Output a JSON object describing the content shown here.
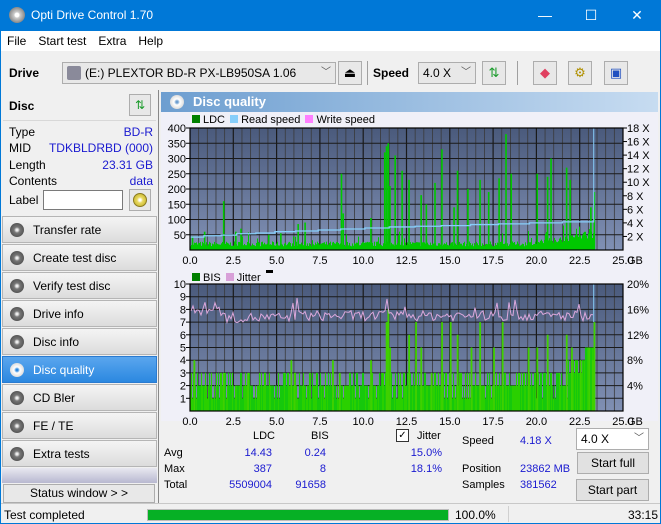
{
  "window": {
    "title": "Opti Drive Control 1.70",
    "controls": {
      "minimize": "—",
      "maximize": "☐",
      "close": "✕"
    }
  },
  "menu": [
    "File",
    "Start test",
    "Extra",
    "Help"
  ],
  "toolbar": {
    "drive_label": "Drive",
    "drive_value": "(E:)  PLEXTOR BD-R  PX-LB950SA 1.06",
    "speed_label": "Speed",
    "speed_value": "4.0 X",
    "icons": [
      "eject-icon",
      "refresh-icon",
      "erase-icon",
      "settings-icon",
      "save-icon"
    ]
  },
  "disc": {
    "header": "Disc",
    "rows": [
      {
        "key": "Type",
        "value": "BD-R"
      },
      {
        "key": "MID",
        "value": "TDKBLDRBD (000)"
      },
      {
        "key": "Length",
        "value": "23.31 GB"
      },
      {
        "key": "Contents",
        "value": "data"
      }
    ],
    "label_key": "Label",
    "label_value": ""
  },
  "nav": [
    {
      "label": "Transfer rate",
      "active": false
    },
    {
      "label": "Create test disc",
      "active": false
    },
    {
      "label": "Verify test disc",
      "active": false
    },
    {
      "label": "Drive info",
      "active": false
    },
    {
      "label": "Disc info",
      "active": false
    },
    {
      "label": "Disc quality",
      "active": true
    },
    {
      "label": "CD Bler",
      "active": false
    },
    {
      "label": "FE / TE",
      "active": false
    },
    {
      "label": "Extra tests",
      "active": false
    }
  ],
  "status_window_button": "Status window > >",
  "panel": {
    "title": "Disc quality"
  },
  "chart_data": [
    {
      "type": "bar",
      "title": "LDC",
      "legend": [
        {
          "name": "LDC",
          "color": "#008000"
        },
        {
          "name": "Read speed",
          "color": "#87cefa"
        },
        {
          "name": "Write speed",
          "color": "#ff80ff"
        }
      ],
      "xlabel": "GB",
      "x_ticks": [
        "0.0",
        "2.5",
        "5.0",
        "7.5",
        "10.0",
        "12.5",
        "15.0",
        "17.5",
        "20.0",
        "22.5",
        "25.0"
      ],
      "xlim": [
        0,
        25
      ],
      "y_ticks": [
        "50",
        "100",
        "150",
        "200",
        "250",
        "300",
        "350",
        "400"
      ],
      "ylim": [
        0,
        400
      ],
      "y2_ticks": [
        "2 X",
        "4 X",
        "6 X",
        "8 X",
        "10 X",
        "12 X",
        "14 X",
        "16 X",
        "18 X"
      ],
      "y2lim": [
        0,
        18
      ],
      "baseline": 20,
      "spikes": [
        [
          0.1,
          45
        ],
        [
          0.8,
          60
        ],
        [
          1.9,
          160
        ],
        [
          2.6,
          60
        ],
        [
          2.9,
          70
        ],
        [
          4.5,
          50
        ],
        [
          5.2,
          55
        ],
        [
          6.2,
          85
        ],
        [
          6.6,
          90
        ],
        [
          8.7,
          250
        ],
        [
          8.8,
          120
        ],
        [
          10.4,
          105
        ],
        [
          11.2,
          320
        ],
        [
          11.3,
          340
        ],
        [
          11.4,
          350
        ],
        [
          11.5,
          210
        ],
        [
          11.8,
          310
        ],
        [
          12.2,
          260
        ],
        [
          12.6,
          230
        ],
        [
          13.3,
          180
        ],
        [
          13.6,
          150
        ],
        [
          14.1,
          220
        ],
        [
          14.5,
          330
        ],
        [
          15.2,
          140
        ],
        [
          15.4,
          260
        ],
        [
          16.0,
          200
        ],
        [
          16.7,
          230
        ],
        [
          17.2,
          190
        ],
        [
          17.8,
          235
        ],
        [
          18.2,
          380
        ],
        [
          18.5,
          250
        ],
        [
          20.0,
          250
        ],
        [
          20.6,
          240
        ],
        [
          20.8,
          300
        ],
        [
          21.7,
          270
        ],
        [
          21.9,
          230
        ],
        [
          23.1,
          140
        ],
        [
          23.3,
          190
        ]
      ],
      "read_speed": [
        [
          0,
          1.9
        ],
        [
          0.8,
          2.1
        ],
        [
          1.8,
          2.2
        ],
        [
          2.7,
          2.4
        ],
        [
          3.8,
          2.5
        ],
        [
          4.9,
          2.7
        ],
        [
          6.1,
          2.8
        ],
        [
          7.4,
          2.95
        ],
        [
          8.7,
          3.1
        ],
        [
          10.1,
          3.25
        ],
        [
          11.5,
          3.4
        ],
        [
          13.0,
          3.5
        ],
        [
          14.5,
          3.6
        ],
        [
          16.2,
          3.75
        ],
        [
          17.8,
          3.85
        ],
        [
          19.6,
          4.0
        ],
        [
          21.5,
          4.15
        ],
        [
          23.3,
          4.18
        ]
      ],
      "end_gb": 23.31
    },
    {
      "type": "bar",
      "title": "BIS",
      "legend": [
        {
          "name": "BIS",
          "color": "#008000"
        },
        {
          "name": "Jitter",
          "color": "#d8a0d8"
        }
      ],
      "xlabel": "GB",
      "x_ticks": [
        "0.0",
        "2.5",
        "5.0",
        "7.5",
        "10.0",
        "12.5",
        "15.0",
        "17.5",
        "20.0",
        "22.5",
        "25.0"
      ],
      "xlim": [
        0,
        25
      ],
      "y_ticks": [
        "1",
        "2",
        "3",
        "4",
        "5",
        "6",
        "7",
        "8",
        "9",
        "10"
      ],
      "ylim": [
        0,
        10
      ],
      "y2_ticks": [
        "4%",
        "8%",
        "12%",
        "16%",
        "20%"
      ],
      "y2lim": [
        0,
        20
      ],
      "bis_spikes": [
        [
          0.2,
          4
        ],
        [
          1.9,
          3
        ],
        [
          3.3,
          3
        ],
        [
          5.8,
          4
        ],
        [
          6.0,
          3
        ],
        [
          8.2,
          4
        ],
        [
          8.6,
          3
        ],
        [
          10.4,
          4
        ],
        [
          11.3,
          7
        ],
        [
          11.4,
          8
        ],
        [
          11.5,
          5
        ],
        [
          12.6,
          6
        ],
        [
          13.0,
          7
        ],
        [
          13.3,
          5
        ],
        [
          13.9,
          3
        ],
        [
          14.5,
          7
        ],
        [
          15.0,
          7
        ],
        [
          15.4,
          6
        ],
        [
          16.2,
          5
        ],
        [
          16.7,
          7
        ],
        [
          17.5,
          5
        ],
        [
          18.0,
          7
        ],
        [
          19.5,
          5
        ],
        [
          20.0,
          5
        ],
        [
          20.6,
          6
        ],
        [
          21.7,
          6
        ],
        [
          22.0,
          5
        ],
        [
          22.5,
          4
        ],
        [
          23.0,
          5
        ],
        [
          23.2,
          4
        ],
        [
          23.3,
          7
        ]
      ],
      "jitter_avg_pct": 15.0,
      "jitter_max_pct": 18.1,
      "end_gb": 23.31
    }
  ],
  "stats": {
    "col_ldc": "LDC",
    "col_bis": "BIS",
    "jitter_label": "Jitter",
    "jitter_checked": true,
    "rows": [
      {
        "label": "Avg",
        "ldc": "14.43",
        "bis": "0.24",
        "jitter": "15.0%"
      },
      {
        "label": "Max",
        "ldc": "387",
        "bis": "8",
        "jitter": "18.1%"
      },
      {
        "label": "Total",
        "ldc": "5509004",
        "bis": "91658",
        "jitter": ""
      }
    ],
    "speed_label": "Speed",
    "speed_value": "4.18 X",
    "position_label": "Position",
    "position_value": "23862 MB",
    "samples_label": "Samples",
    "samples_value": "381562",
    "speed_select": "4.0 X",
    "start_full": "Start full",
    "start_part": "Start part"
  },
  "statusbar": {
    "text": "Test completed",
    "progress_pct": 100,
    "progress_text": "100.0%",
    "time": "33:15"
  }
}
